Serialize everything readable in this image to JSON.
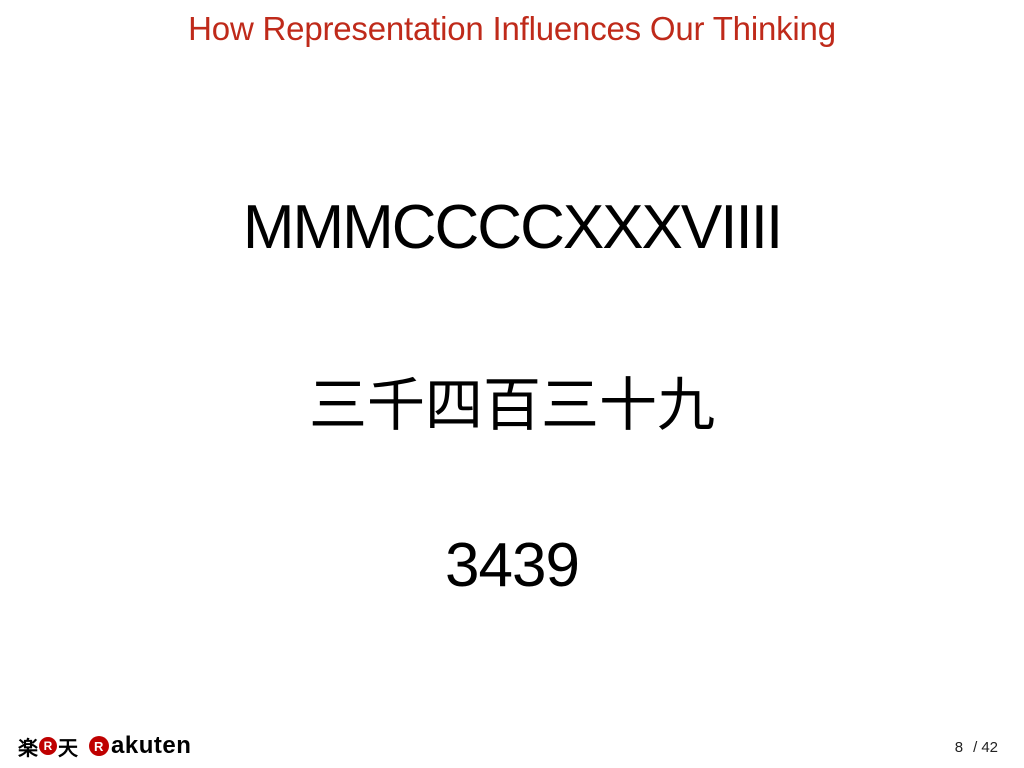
{
  "slide": {
    "title": "How Representation Influences Our Thinking",
    "lines": {
      "roman": "MMMCCCCXXXVIIII",
      "kanji": "三千四百三十九",
      "arabic": "3439"
    }
  },
  "footer": {
    "logo": {
      "kanji_first": "楽",
      "r_mark": "R",
      "kanji_second": "天",
      "wordmark": "akuten",
      "brand_color": "#bf0000"
    },
    "page": {
      "current": "8",
      "separator": "/",
      "total": "42"
    }
  },
  "colors": {
    "title": "#bf2a1a",
    "text": "#000000",
    "background": "#ffffff"
  }
}
